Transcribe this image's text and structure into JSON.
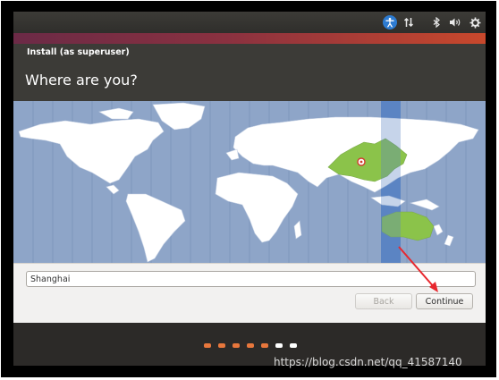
{
  "window": {
    "title": "Install (as superuser)"
  },
  "page": {
    "heading": "Where are you?"
  },
  "top_panel": {
    "indicators": [
      "accessibility-icon",
      "network-icon",
      "bluetooth-icon",
      "volume-icon",
      "settings-gear-icon"
    ]
  },
  "location": {
    "value": "Shanghai",
    "selected_timezone_highlight": "China"
  },
  "buttons": {
    "back": "Back",
    "continue": "Continue",
    "back_enabled": false
  },
  "progress": {
    "total_steps": 7,
    "completed_steps": 5
  },
  "colors": {
    "ocean": "#8ea5c8",
    "land": "#ffffff",
    "selected_region": "#8bc34a",
    "timezone_band": "#5b84c4",
    "progress_active": "#e8773c",
    "progress_inactive": "#ffffff",
    "annotation_arrow": "#e8272e"
  },
  "watermark": "https://blog.csdn.net/qq_41587140"
}
